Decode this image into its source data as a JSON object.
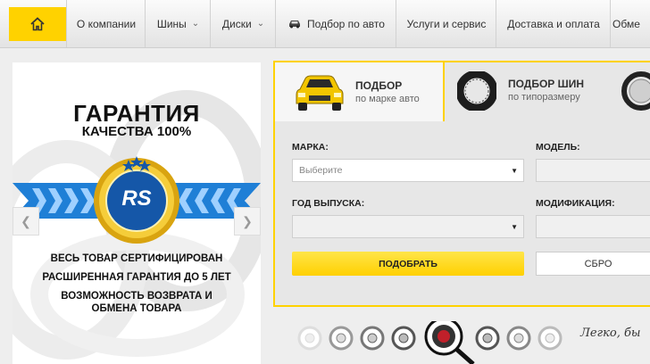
{
  "nav": {
    "items": [
      {
        "label": "О компании",
        "dropdown": false
      },
      {
        "label": "Шины",
        "dropdown": true
      },
      {
        "label": "Диски",
        "dropdown": true
      },
      {
        "label": "Подбор по авто",
        "dropdown": false
      },
      {
        "label": "Услуги и сервис",
        "dropdown": false
      },
      {
        "label": "Доставка и оплата",
        "dropdown": false
      },
      {
        "label": "Обме",
        "dropdown": false
      }
    ]
  },
  "banner": {
    "title": "ГАРАНТИЯ",
    "subtitle": "КАЧЕСТВА 100%",
    "badge_text": "RS",
    "lines": [
      "ВЕСЬ ТОВАР СЕРТИФИЦИРОВАН",
      "РАСШИРЕННАЯ ГАРАНТИЯ ДО 5 ЛЕТ",
      "ВОЗМОЖНОСТЬ ВОЗВРАТА И",
      "ОБМЕНА ТОВАРА"
    ]
  },
  "selector": {
    "tabs": [
      {
        "title": "ПОДБОР",
        "subtitle": "по марке авто"
      },
      {
        "title": "ПОДБОР ШИН",
        "subtitle": "по типоразмеру"
      }
    ],
    "fields": {
      "make": {
        "label": "МАРКА:",
        "value": "Выберите"
      },
      "model": {
        "label": "МОДЕЛЬ:",
        "value": ""
      },
      "year": {
        "label": "ГОД ВЫПУСКА:",
        "value": ""
      },
      "modification": {
        "label": "МОДИФИКАЦИЯ:",
        "value": ""
      }
    },
    "submit_label": "ПОДОБРАТЬ",
    "reset_label": "СБРО"
  },
  "slogan": "Легко, бы",
  "colors": {
    "accent": "#ffd200",
    "panel": "#e7e7e7",
    "ribbon": "#1f7fd6"
  }
}
